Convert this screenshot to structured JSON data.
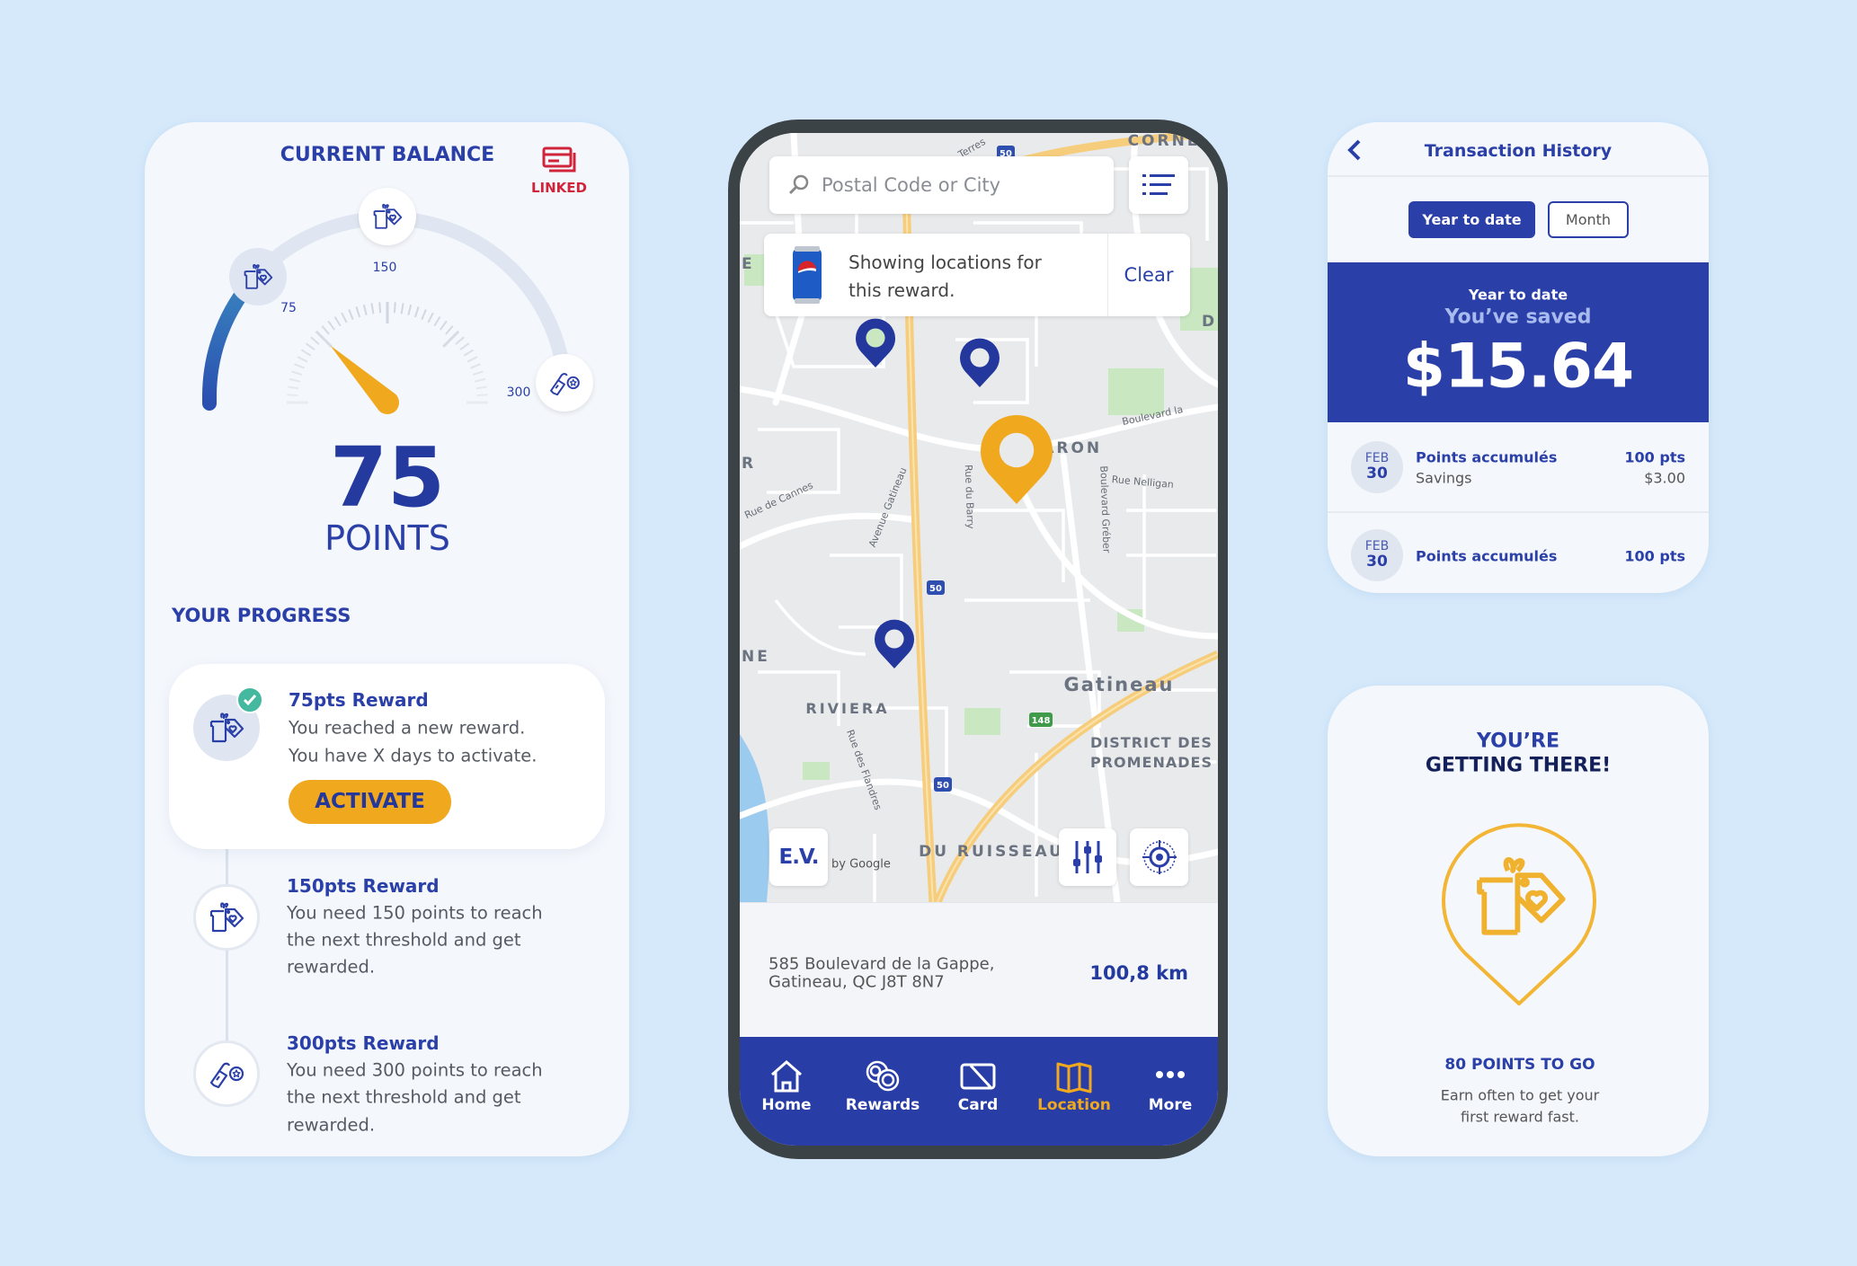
{
  "colors": {
    "background": "#d5e9fb",
    "brand_blue": "#2a3fa8",
    "accent_orange": "#f0a81e",
    "linked_red": "#d0243b",
    "check_teal": "#45b9a0",
    "phone_bezel": "#3b4347"
  },
  "balance": {
    "title": "CURRENT BALANCE",
    "linked_label": "LINKED",
    "linked_icon": "linked-cards-icon",
    "gauge": {
      "value": 75,
      "max": 300,
      "milestones": [
        {
          "value": 75,
          "label": "75",
          "icon": "gift-tag-icon",
          "reached": true
        },
        {
          "value": 150,
          "label": "150",
          "icon": "gift-tag-icon",
          "reached": false
        },
        {
          "value": 300,
          "label": "300",
          "icon": "fuel-coin-icon",
          "reached": false
        }
      ]
    },
    "points_value": "75",
    "points_label": "POINTS"
  },
  "progress": {
    "title": "YOUR PROGRESS",
    "items": [
      {
        "title": "75pts Reward",
        "lines": [
          "You reached a new reward.",
          "You have X days to activate."
        ],
        "button": "ACTIVATE",
        "icon": "gift-tag-icon",
        "reached": true
      },
      {
        "title": "150pts Reward",
        "lines": [
          "You need 150 points to reach",
          "the next threshold and get",
          "rewarded."
        ],
        "icon": "gift-tag-icon",
        "reached": false
      },
      {
        "title": "300pts Reward",
        "lines": [
          "You need 300 points to reach",
          "the next threshold and get",
          "rewarded."
        ],
        "icon": "fuel-coin-icon",
        "reached": false
      }
    ]
  },
  "map_screen": {
    "search_placeholder": "Postal Code or City",
    "banner_text_lines": [
      "Showing locations for",
      "this reward."
    ],
    "banner_clear": "Clear",
    "ev_button": "E.V.",
    "attribution": "by Google",
    "map_labels": {
      "corne": "CORNE",
      "le_baron": "LE BARON",
      "gatineau": "Gatineau",
      "riviera": "RIVIERA",
      "district1": "DISTRICT DES",
      "district2": "PROMENADES",
      "ruisseau": "DU RUISSEAU",
      "blvd_la": "Boulevard la",
      "nelligan": "Rue Nelligan",
      "cannes": "Rue de Cannes",
      "av_gatineau": "Avenue Gatineau",
      "barry": "Rue du Barry",
      "greber": "Boulevard Gréber",
      "flandres": "Rue des Flandres",
      "terres": "Terres",
      "edge_e": "E",
      "edge_r": "R",
      "edge_ne": "NE",
      "edge_di": "DI",
      "shield_50": "50",
      "shield_148": "148"
    },
    "address_lines": [
      "585 Boulevard de la Gappe,",
      "Gatineau, QC J8T 8N7"
    ],
    "distance": "100,8 km",
    "tabs": [
      {
        "label": "Home",
        "icon": "home-icon",
        "active": false
      },
      {
        "label": "Rewards",
        "icon": "coins-icon",
        "active": false
      },
      {
        "label": "Card",
        "icon": "card-icon",
        "active": false
      },
      {
        "label": "Location",
        "icon": "map-icon",
        "active": true
      },
      {
        "label": "More",
        "icon": "more-dots-icon",
        "active": false
      }
    ]
  },
  "transactions": {
    "title": "Transaction History",
    "segments": [
      {
        "label": "Year to date",
        "active": true
      },
      {
        "label": "Month",
        "active": false
      }
    ],
    "summary_period": "Year to date",
    "summary_label": "You’ve saved",
    "summary_amount": "$15.64",
    "rows": [
      {
        "month": "FEB",
        "day": "30",
        "title": "Points accumulés",
        "subtitle": "Savings",
        "points": "100 pts",
        "amount": "$3.00"
      },
      {
        "month": "FEB",
        "day": "30",
        "title": "Points accumulés",
        "points": "100 pts"
      }
    ]
  },
  "promo": {
    "title_line1": "YOU’RE",
    "title_line2": "GETTING THERE!",
    "points_to_go": "80 POINTS TO GO",
    "body_lines": [
      "Earn often to get your",
      "first reward fast."
    ]
  }
}
